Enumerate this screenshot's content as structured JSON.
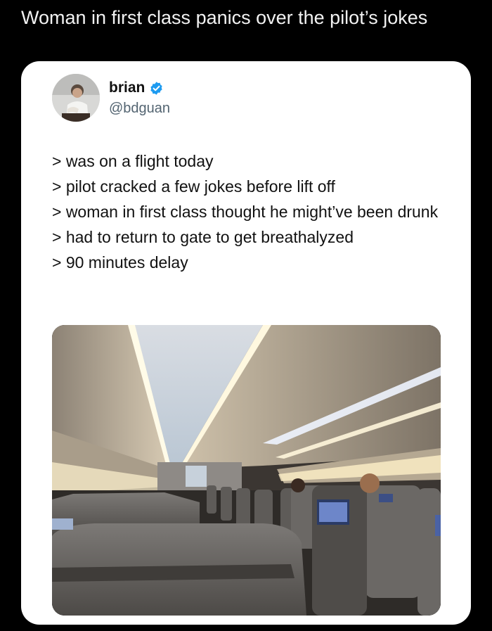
{
  "headline": "Woman in first class panics over the pilot’s jokes",
  "tweet": {
    "author_name": "brian",
    "handle": "@bdguan",
    "lines": [
      "> was on a flight today",
      "> pilot cracked a few jokes before lift off",
      "> woman in first class thought he might’ve been drunk",
      "> had to return to gate to get breathalyzed",
      "> 90 minutes delay"
    ]
  },
  "colors": {
    "background": "#000000",
    "card": "#ffffff",
    "handle": "#536471",
    "verified": "#1d9bf0"
  },
  "icons": [
    "verified-badge-icon"
  ]
}
